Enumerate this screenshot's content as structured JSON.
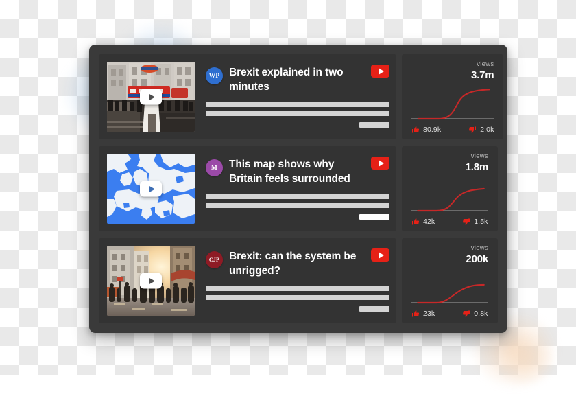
{
  "panel": {
    "title": "video-performance-list"
  },
  "rows": [
    {
      "thumbnail_name": "london-street-thumbnail",
      "play_label": "play-button",
      "avatar": {
        "initials": "WP",
        "color": "#2f6fd0"
      },
      "title": "Brexit explained in two minutes",
      "youtube_badge": "youtube-play-badge",
      "stats": {
        "views_label": "views",
        "views_value": "3.7m",
        "likes": "80.9k",
        "dislikes": "2.0k",
        "curve_color": "#c62828"
      }
    },
    {
      "thumbnail_name": "europe-map-thumbnail",
      "play_label": "play-button",
      "avatar": {
        "initials": "M",
        "color": "#9b4aa8"
      },
      "title": "This map shows why Britain feels surrounded",
      "youtube_badge": "youtube-play-badge",
      "stats": {
        "views_label": "views",
        "views_value": "1.8m",
        "likes": "42k",
        "dislikes": "1.5k",
        "curve_color": "#c62828"
      }
    },
    {
      "thumbnail_name": "city-crowd-sunset-thumbnail",
      "play_label": "play-button",
      "avatar": {
        "initials": "CJP",
        "color": "#8e1b25"
      },
      "title": "Brexit: can the system be unrigged?",
      "youtube_badge": "youtube-play-badge",
      "stats": {
        "views_label": "views",
        "views_value": "200k",
        "likes": "23k",
        "dislikes": "0.8k",
        "curve_color": "#c62828"
      }
    }
  ],
  "colors": {
    "panel_bg": "#3a3a3a",
    "card_bg": "#333333",
    "accent_red": "#e62117",
    "bar_gray": "#d4d4d4"
  }
}
